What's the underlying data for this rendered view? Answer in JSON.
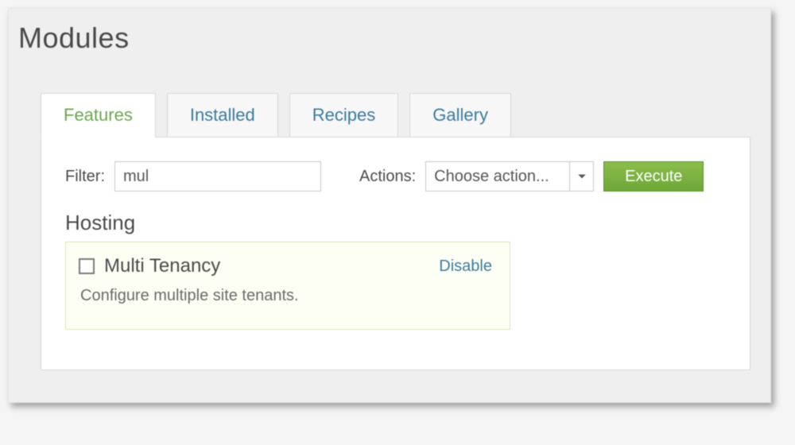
{
  "page": {
    "title": "Modules"
  },
  "tabs": {
    "features": "Features",
    "installed": "Installed",
    "recipes": "Recipes",
    "gallery": "Gallery"
  },
  "toolbar": {
    "filter_label": "Filter:",
    "filter_value": "mul",
    "actions_label": "Actions:",
    "actions_selected": "Choose action...",
    "execute_label": "Execute"
  },
  "group": {
    "title": "Hosting"
  },
  "feature": {
    "name": "Multi Tenancy",
    "description": "Configure multiple site tenants.",
    "action_link": "Disable"
  }
}
